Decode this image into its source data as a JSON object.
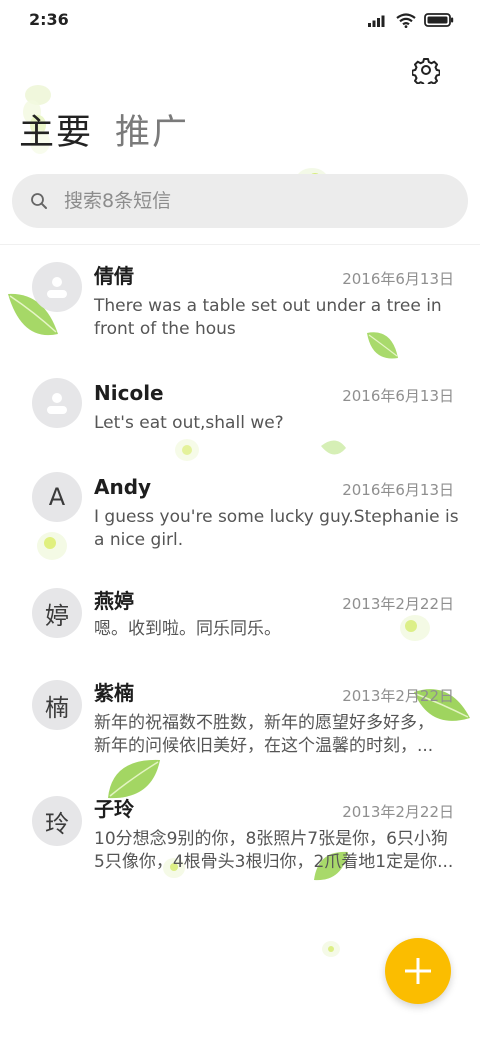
{
  "status_bar": {
    "time": "2:36"
  },
  "tabs": [
    {
      "label": "主要",
      "active": true
    },
    {
      "label": "推广",
      "active": false
    }
  ],
  "search": {
    "placeholder": "搜索8条短信"
  },
  "conversations": [
    {
      "name": "倩倩",
      "date": "2016年6月13日",
      "preview_line1": "There was a table set out under a tree in",
      "preview_line2": "front of the hous",
      "avatar": "person-icon"
    },
    {
      "name": "Nicole",
      "date": "2016年6月13日",
      "preview_line1": "Let's eat out,shall we?",
      "preview_line2": "",
      "avatar": "person-icon"
    },
    {
      "name": "Andy",
      "date": "2016年6月13日",
      "preview_line1": "I guess you're some lucky guy.Stephanie is",
      "preview_line2": "a nice girl.",
      "avatar_letter": "A"
    },
    {
      "name": "燕婷",
      "date": "2013年2月22日",
      "preview_line1": "嗯。收到啦。同乐同乐。",
      "preview_line2": "",
      "avatar_letter": "婷"
    },
    {
      "name": "紫楠",
      "date": "2013年2月22日",
      "preview_line1": "新年的祝福数不胜数，新年的愿望好多好多，",
      "preview_line2": "新年的问候依旧美好，在这个温馨的时刻，...",
      "avatar_letter": "楠"
    },
    {
      "name": "子玲",
      "date": "2013年2月22日",
      "preview_line1": "10分想念9别的你，8张照片7张是你，6只小狗",
      "preview_line2": "5只像你，4根骨头3根归你，2爪着地1定是你...",
      "avatar_letter": "玲"
    }
  ],
  "colors": {
    "fab": "#fbbd00",
    "search_bg": "#ececec",
    "avatar_bg": "#e6e6e8"
  },
  "icons": {
    "settings": "gear-icon",
    "search": "search-icon",
    "compose": "plus-icon"
  }
}
